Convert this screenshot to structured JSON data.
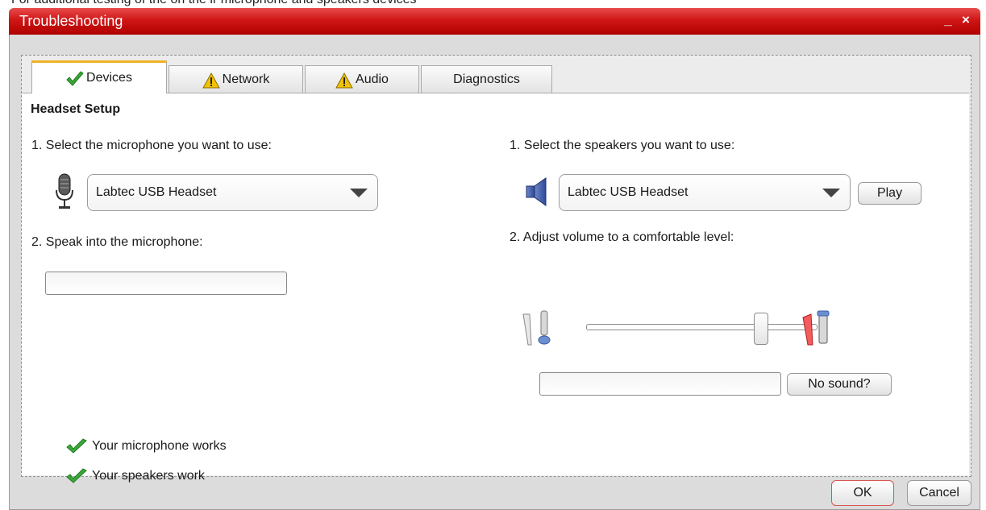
{
  "top_caption": "For additional testing of the on the ir microphone and speakers devices",
  "window": {
    "title": "Troubleshooting",
    "minimize": "_",
    "close": "×"
  },
  "tabs": [
    {
      "label": "Devices",
      "icon": "check-icon",
      "active": true
    },
    {
      "label": "Network",
      "icon": "warning-icon"
    },
    {
      "label": "Audio",
      "icon": "warning-icon"
    },
    {
      "label": "Diagnostics"
    }
  ],
  "section_title": "Headset Setup",
  "microphone": {
    "step1": "1. Select the microphone you want to use:",
    "selected": "Labtec USB Headset",
    "step2": "2. Speak into the microphone:"
  },
  "speakers": {
    "step1": "1. Select the speakers you want to use:",
    "selected": "Labtec USB Headset",
    "play": "Play",
    "step2": "2. Adjust volume to a comfortable level:",
    "volume_level": 0.78,
    "no_sound": "No sound?"
  },
  "status": {
    "mic_works": "Your microphone works",
    "speakers_work": "Your speakers work"
  },
  "footer": {
    "ok": "OK",
    "cancel": "Cancel"
  },
  "colors": {
    "titlebar": "#c81010",
    "tab_accent": "#f0b323",
    "check": "#3aa83a",
    "ok_border": "#d9534f"
  }
}
